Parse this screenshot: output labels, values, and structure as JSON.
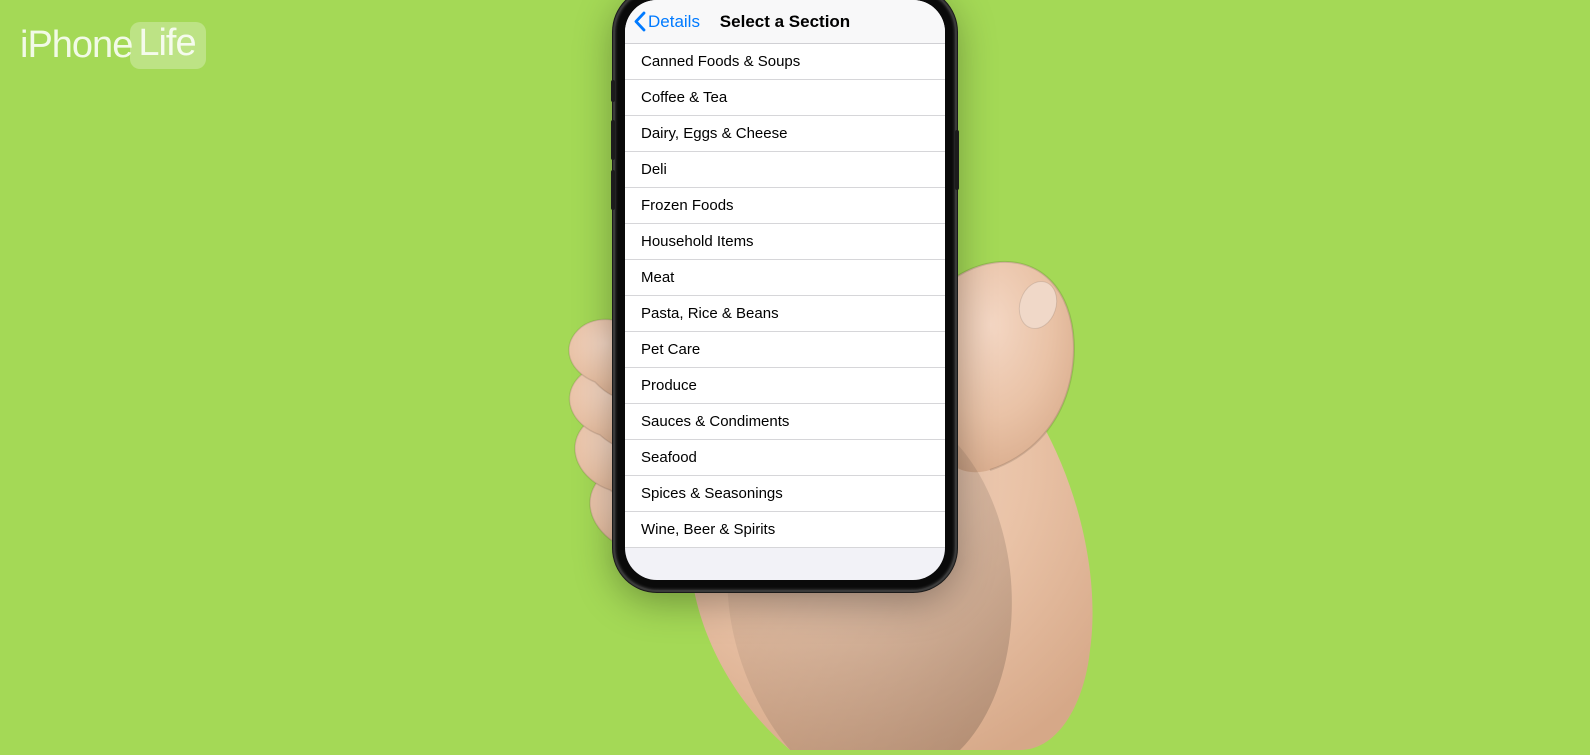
{
  "watermark": {
    "left": "iPhone",
    "right": "Life"
  },
  "nav": {
    "back_label": "Details",
    "title": "Select a Section"
  },
  "sections": [
    "Canned Foods & Soups",
    "Coffee & Tea",
    "Dairy, Eggs & Cheese",
    "Deli",
    "Frozen Foods",
    "Household Items",
    "Meat",
    "Pasta, Rice & Beans",
    "Pet Care",
    "Produce",
    "Sauces & Condiments",
    "Seafood",
    "Spices & Seasonings",
    "Wine, Beer & Spirits"
  ],
  "colors": {
    "background": "#a4d956",
    "ios_blue": "#007aff"
  }
}
